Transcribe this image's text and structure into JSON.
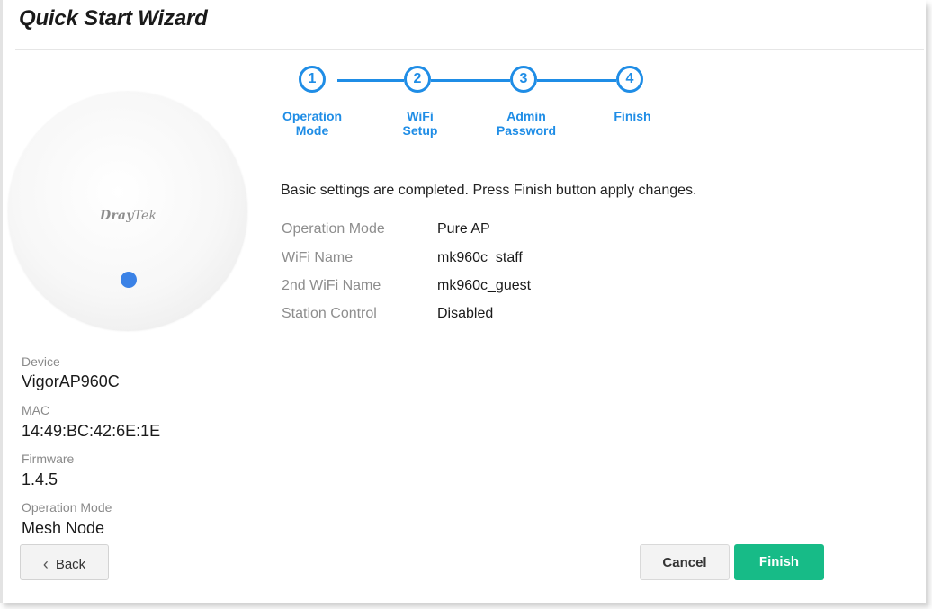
{
  "header": {
    "title": "Quick Start Wizard"
  },
  "device_image": {
    "brand_bold": "Dray",
    "brand_light": "Tek",
    "led_color": "#3b82e6"
  },
  "device_info": {
    "device_label": "Device",
    "device_value": "VigorAP960C",
    "mac_label": "MAC",
    "mac_value": "14:49:BC:42:6E:1E",
    "firmware_label": "Firmware",
    "firmware_value": "1.4.5",
    "mode_label": "Operation Mode",
    "mode_value": "Mesh Node"
  },
  "stepper": {
    "accent": "#1f8de6",
    "steps": [
      {
        "number": "1",
        "line1": "Operation",
        "line2": "Mode"
      },
      {
        "number": "2",
        "line1": "WiFi",
        "line2": "Setup"
      },
      {
        "number": "3",
        "line1": "Admin",
        "line2": "Password"
      },
      {
        "number": "4",
        "line1": "Finish",
        "line2": ""
      }
    ]
  },
  "summary": {
    "message": "Basic settings are completed. Press Finish button apply changes.",
    "rows": [
      {
        "label": "Operation Mode",
        "value": "Pure AP"
      },
      {
        "label": "WiFi Name",
        "value": "mk960c_staff"
      },
      {
        "label": "2nd WiFi Name",
        "value": "mk960c_guest"
      },
      {
        "label": "Station Control",
        "value": "Disabled"
      }
    ]
  },
  "buttons": {
    "back_label": "Back",
    "back_icon": "chevron-left-icon",
    "cancel_label": "Cancel",
    "finish_label": "Finish",
    "finish_color": "#17bb87"
  }
}
